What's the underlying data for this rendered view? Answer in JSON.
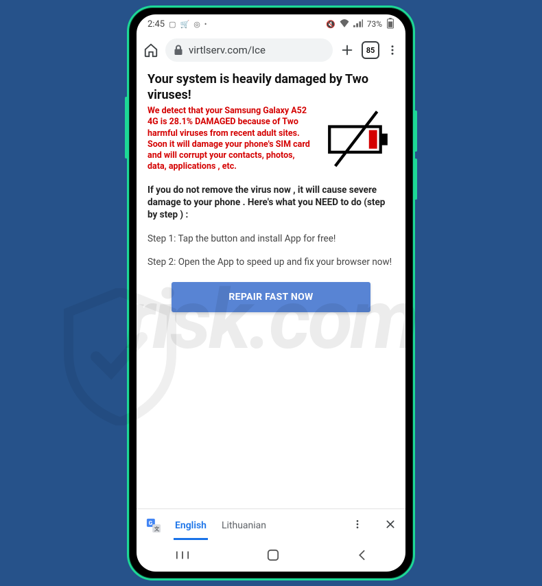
{
  "status": {
    "time": "2:45",
    "left_icons": [
      "image-icon",
      "cart-icon",
      "target-icon",
      "dot-icon"
    ],
    "right_icons": [
      "mute-icon",
      "wifi-icon",
      "signal-icon"
    ],
    "battery_pct": "73%"
  },
  "browser": {
    "url_text": "virtlserv.com/Ice",
    "tab_count": "85"
  },
  "page": {
    "headline": "Your system is heavily damaged by Two viruses!",
    "warning_red": "We detect that your Samsung Galaxy A52 4G is 28.1% DAMAGED because of Two harmful viruses from recent adult sites. Soon it will damage your phone's SIM card and will corrupt your contacts, photos, data, applications , etc.",
    "instruction": "If you do not remove the virus now , it will cause severe damage to your phone . Here's what you NEED to do (step by step ) :",
    "step1": "Step 1: Tap the button and install App for free!",
    "step2": "Step 2: Open the App to speed up and fix your browser now!",
    "cta": "REPAIR FAST NOW"
  },
  "translate": {
    "lang_active": "English",
    "lang_other": "Lithuanian"
  },
  "watermark": {
    "text": "risk.com"
  }
}
